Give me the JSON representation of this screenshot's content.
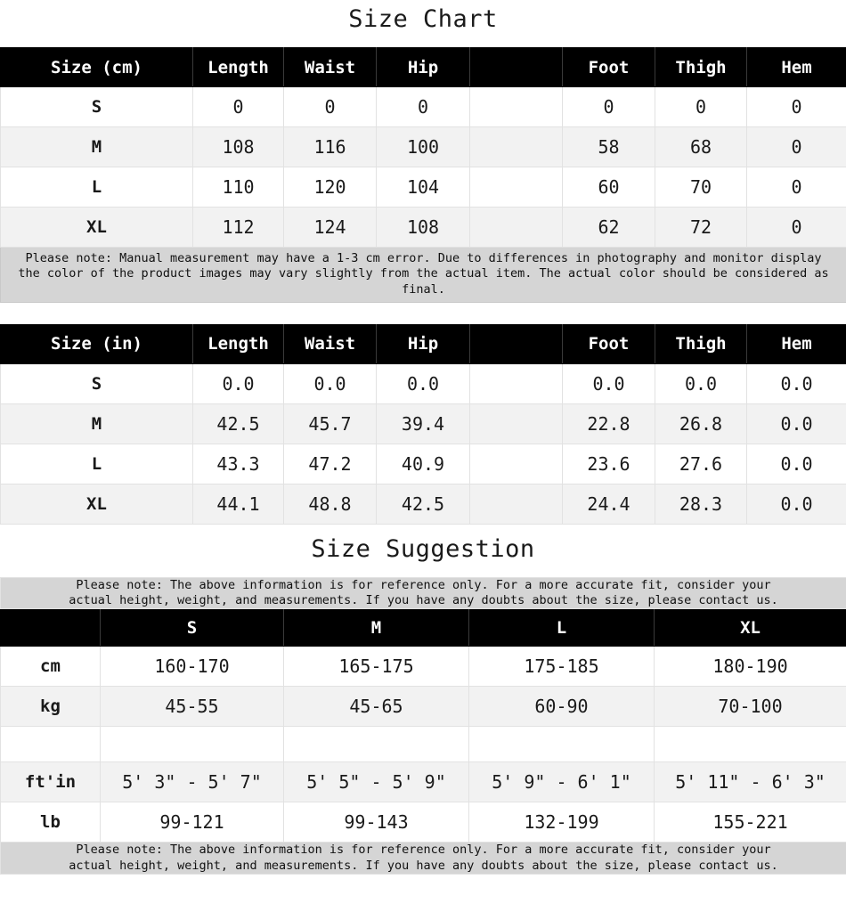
{
  "titles": {
    "size_chart": "Size Chart",
    "size_suggestion": "Size Suggestion"
  },
  "colors": {
    "header_bg": "#000000",
    "header_text": "#ffffff",
    "row_alt_bg": "#f2f2f2",
    "note_bg": "#d5d5d5",
    "border": "#e2e2e2",
    "text": "#1a1a1a"
  },
  "cm_table": {
    "headers": [
      "Size (cm)",
      "Length",
      "Waist",
      "Hip",
      "",
      "Foot",
      "Thigh",
      "Hem"
    ],
    "rows": [
      {
        "size": "S",
        "values": [
          "0",
          "0",
          "0",
          "",
          "0",
          "0",
          "0"
        ]
      },
      {
        "size": "M",
        "values": [
          "108",
          "116",
          "100",
          "",
          "58",
          "68",
          "0"
        ]
      },
      {
        "size": "L",
        "values": [
          "110",
          "120",
          "104",
          "",
          "60",
          "70",
          "0"
        ]
      },
      {
        "size": "XL",
        "values": [
          "112",
          "124",
          "108",
          "",
          "62",
          "72",
          "0"
        ]
      }
    ],
    "note_line1": "Please note: Manual measurement may have a 1-3 cm error. Due to differences in photography and monitor display",
    "note_line2": "the color of the product images may vary slightly from the actual item. The actual color should be considered as final."
  },
  "in_table": {
    "headers": [
      "Size (in)",
      "Length",
      "Waist",
      "Hip",
      "",
      "Foot",
      "Thigh",
      "Hem"
    ],
    "rows": [
      {
        "size": "S",
        "values": [
          "0.0",
          "0.0",
          "0.0",
          "",
          "0.0",
          "0.0",
          "0.0"
        ]
      },
      {
        "size": "M",
        "values": [
          "42.5",
          "45.7",
          "39.4",
          "",
          "22.8",
          "26.8",
          "0.0"
        ]
      },
      {
        "size": "L",
        "values": [
          "43.3",
          "47.2",
          "40.9",
          "",
          "23.6",
          "27.6",
          "0.0"
        ]
      },
      {
        "size": "XL",
        "values": [
          "44.1",
          "48.8",
          "42.5",
          "",
          "24.4",
          "28.3",
          "0.0"
        ]
      }
    ]
  },
  "suggestion_table": {
    "top_note_line1": "Please note: The above information is for reference only. For a more accurate fit, consider your",
    "top_note_line2": "actual height, weight, and measurements. If you have any doubts about the size, please contact us.",
    "headers": [
      "",
      "S",
      "M",
      "L",
      "XL"
    ],
    "rows": [
      {
        "unit": "cm",
        "values": [
          "160-170",
          "165-175",
          "175-185",
          "180-190"
        ]
      },
      {
        "unit": "kg",
        "values": [
          "45-55",
          "45-65",
          "60-90",
          "70-100"
        ]
      },
      {
        "unit": "ft'in",
        "values": [
          "5' 3\" - 5' 7\"",
          "5' 5\" - 5' 9\"",
          "5' 9\" - 6' 1\"",
          "5' 11\" - 6' 3\""
        ]
      },
      {
        "unit": "lb",
        "values": [
          "99-121",
          "99-143",
          "132-199",
          "155-221"
        ]
      }
    ],
    "bottom_note_line1": "Please note: The above information is for reference only. For a more accurate fit, consider your",
    "bottom_note_line2": "actual height, weight, and measurements. If you have any doubts about the size, please contact us."
  }
}
